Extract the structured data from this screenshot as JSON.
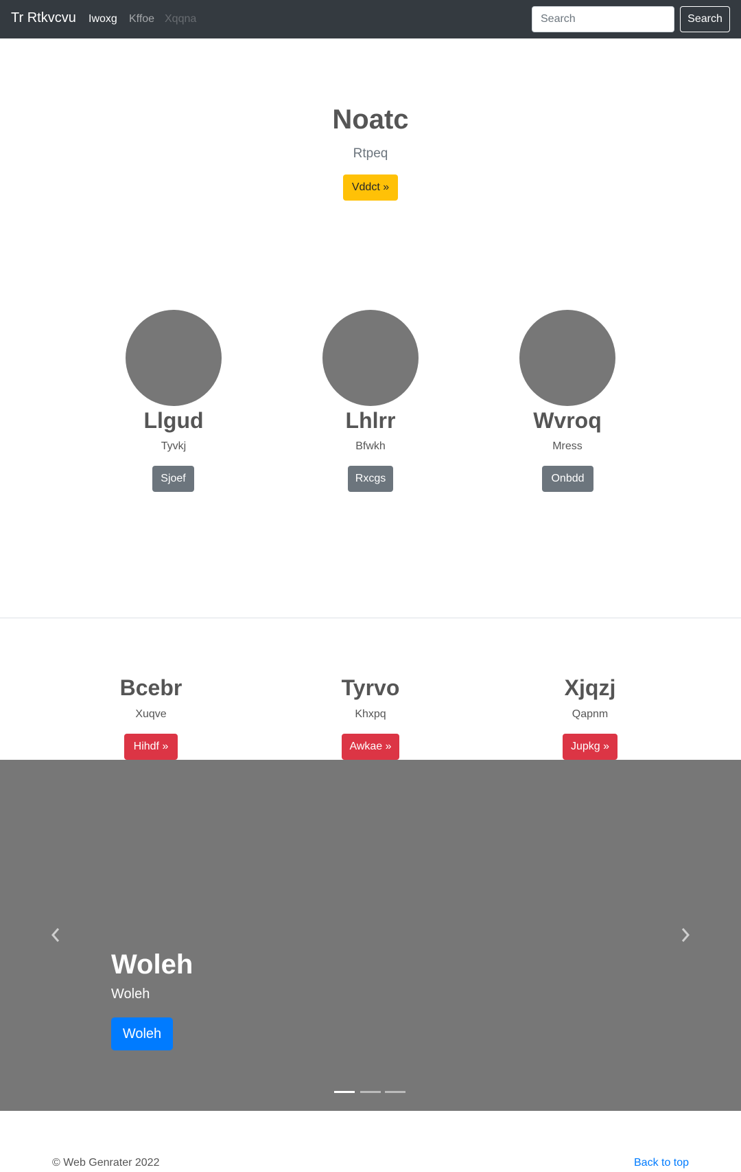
{
  "navbar": {
    "brand": "Tr Rtkvcvu",
    "links": [
      {
        "label": "Iwoxg",
        "state": "active"
      },
      {
        "label": "Kffoe",
        "state": "normal"
      },
      {
        "label": "Xqqna",
        "state": "disabled"
      }
    ],
    "search_placeholder": "Search",
    "search_button": "Search"
  },
  "hero": {
    "title": "Noatc",
    "subtitle": "Rtpeq",
    "button": "Vddct »"
  },
  "features": [
    {
      "title": "Llgud",
      "text": "Tyvkj",
      "button": "Sjoef"
    },
    {
      "title": "Lhlrr",
      "text": "Bfwkh",
      "button": "Rxcgs"
    },
    {
      "title": "Wvroq",
      "text": "Mress",
      "button": "Onbdd"
    }
  ],
  "columns": [
    {
      "title": "Bcebr",
      "text": "Xuqve",
      "button": "Hihdf »"
    },
    {
      "title": "Tyrvo",
      "text": "Khxpq",
      "button": "Awkae »"
    },
    {
      "title": "Xjqzj",
      "text": "Qapnm",
      "button": "Jupkg »"
    }
  ],
  "carousel": {
    "title": "Woleh",
    "subtitle": "Woleh",
    "button": "Woleh",
    "slides": 3,
    "active_slide": 1,
    "prev_icon": "chevron-left-icon",
    "next_icon": "chevron-right-icon"
  },
  "footer": {
    "copyright": "© Web Genrater 2022",
    "back_to_top": "Back to top"
  },
  "colors": {
    "navbar_bg": "#343a40",
    "warning": "#ffc107",
    "secondary": "#6c757d",
    "danger": "#dc3545",
    "primary": "#007bff",
    "placeholder_gray": "#777777"
  }
}
